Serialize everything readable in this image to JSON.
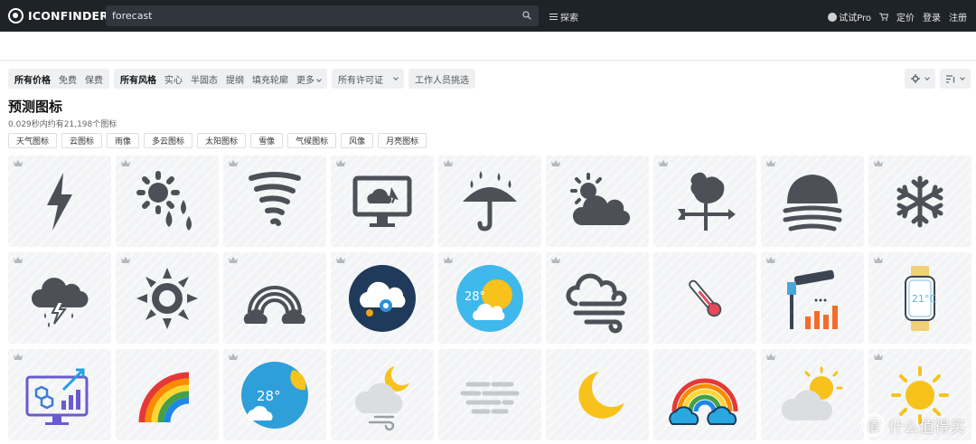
{
  "header": {
    "logo_text": "ICONFINDER",
    "search_value": "forecast",
    "explore_label": "探索",
    "pro_label": "试试Pro",
    "pricing_label": "定价",
    "login_label": "登录",
    "signup_label": "注册"
  },
  "filters": {
    "price": {
      "active": "所有价格",
      "options": [
        "免费",
        "保费"
      ]
    },
    "style": {
      "active": "所有风格",
      "options": [
        "实心",
        "半固态",
        "提纲",
        "填充轮廓"
      ],
      "more": "更多"
    },
    "license": "所有许可证",
    "staff_picks": "工作人员挑选"
  },
  "results": {
    "title": "预测图标",
    "count_text": "0.029秒内约有21,198个图标"
  },
  "tags": [
    "天气图标",
    "云图标",
    "雨像",
    "多云图标",
    "太阳图标",
    "雪像",
    "气候图标",
    "风像",
    "月亮图标"
  ],
  "icons": [
    "lightning-bolt-icon",
    "sun-rain-drops-icon",
    "tornado-icon",
    "monitor-cloud-cursor-icon",
    "umbrella-rain-icon",
    "sun-cloud-icon",
    "weathervane-rooster-icon",
    "cloud-fog-icon",
    "snowflake-icon",
    "thunder-rain-cloud-icon",
    "sun-icon",
    "rainbow-clouds-icon",
    "cloud-settings-badge-icon",
    "sun-28-badge-icon",
    "cloud-wind-icon",
    "thermometer-icon",
    "telescope-chart-icon",
    "smartwatch-21c-icon",
    "monitor-analytics-icon",
    "rainbow-color-icon",
    "weather-28-circle-icon",
    "moon-cloud-wind-icon",
    "fog-lines-icon",
    "crescent-moon-icon",
    "rainbow-blue-clouds-icon",
    "sun-gray-cloud-icon",
    "sun-yellow-icon"
  ],
  "icon_labels": {
    "sun_badge_temp": "28°",
    "weather_circle_temp": "28°",
    "watch_temp": "21°C"
  },
  "watermark": {
    "text": "什么值得买",
    "symbol": "值"
  }
}
